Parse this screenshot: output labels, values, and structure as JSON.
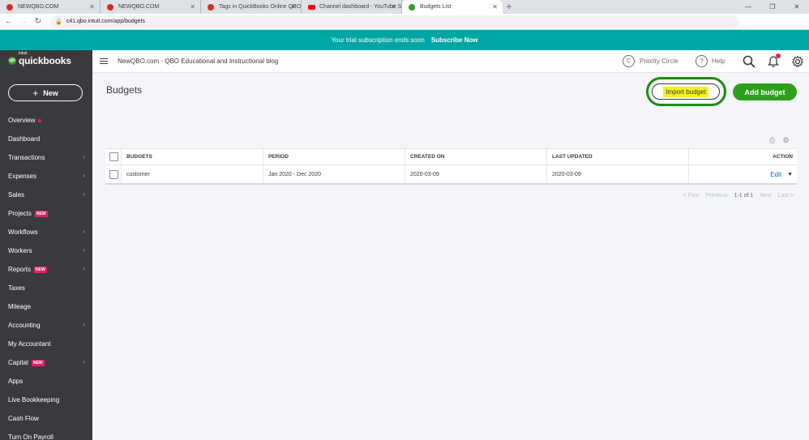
{
  "browser": {
    "tabs": [
      {
        "label": "NEWQBO.COM",
        "icon": "red-circle-icon",
        "active": false
      },
      {
        "label": "NEWQBO.COM",
        "icon": "red-circle-icon",
        "active": false
      },
      {
        "label": "Tags in QuickBooks Online QBO -",
        "icon": "red-circle-icon",
        "active": false
      },
      {
        "label": "Channel dashboard - YouTube St",
        "icon": "youtube-icon",
        "active": false
      },
      {
        "label": "Budgets List",
        "icon": "quickbooks-icon",
        "active": true
      }
    ],
    "url": "c41.qbo.intuit.com/app/budgets"
  },
  "banner": {
    "text": "Your trial subscription ends soon",
    "cta": "Subscribe Now"
  },
  "sidebar": {
    "logo_small": "intuit",
    "logo": "quickbooks",
    "new_label": "New",
    "items": [
      {
        "label": "Overview",
        "dot": true,
        "chevron": false,
        "badge": ""
      },
      {
        "label": "Dashboard",
        "dot": false,
        "chevron": false,
        "badge": ""
      },
      {
        "label": "Transactions",
        "dot": false,
        "chevron": true,
        "badge": ""
      },
      {
        "label": "Expenses",
        "dot": false,
        "chevron": true,
        "badge": ""
      },
      {
        "label": "Sales",
        "dot": false,
        "chevron": true,
        "badge": ""
      },
      {
        "label": "Projects",
        "dot": false,
        "chevron": false,
        "badge": "NEW"
      },
      {
        "label": "Workflows",
        "dot": false,
        "chevron": true,
        "badge": ""
      },
      {
        "label": "Workers",
        "dot": false,
        "chevron": true,
        "badge": ""
      },
      {
        "label": "Reports",
        "dot": false,
        "chevron": true,
        "badge": "NEW"
      },
      {
        "label": "Taxes",
        "dot": false,
        "chevron": false,
        "badge": ""
      },
      {
        "label": "Mileage",
        "dot": false,
        "chevron": false,
        "badge": ""
      },
      {
        "label": "Accounting",
        "dot": false,
        "chevron": true,
        "badge": ""
      },
      {
        "label": "My Accountant",
        "dot": false,
        "chevron": false,
        "badge": ""
      },
      {
        "label": "Capital",
        "dot": false,
        "chevron": true,
        "badge": "NEW"
      },
      {
        "label": "Apps",
        "dot": false,
        "chevron": false,
        "badge": ""
      },
      {
        "label": "Live Bookkeeping",
        "dot": false,
        "chevron": false,
        "badge": ""
      },
      {
        "label": "Cash Flow",
        "dot": false,
        "chevron": false,
        "badge": ""
      },
      {
        "label": "Turn On Payroll",
        "dot": false,
        "chevron": false,
        "badge": ""
      }
    ]
  },
  "header": {
    "company": "NewQBO.com - QBO Educational and Instructional blog",
    "priority_circle": "Priority Circle",
    "help": "Help"
  },
  "main": {
    "title": "Budgets",
    "import_button": "Import budget",
    "add_button": "Add budget",
    "table": {
      "columns": [
        "BUDGETS",
        "PERIOD",
        "CREATED ON",
        "LAST UPDATED",
        "ACTION"
      ],
      "rows": [
        {
          "name": "customer",
          "period": "Jan 2020 - Dec 2020",
          "created": "2020-03-09",
          "updated": "2020-03-09",
          "action": "Edit"
        }
      ]
    },
    "pager": {
      "first": "< First",
      "previous": "Previous",
      "range": "1-1 of 1",
      "next": "Next",
      "last": "Last >"
    }
  },
  "colors": {
    "brand_green": "#2ca01c",
    "banner_teal": "#00a6a4",
    "sidebar_bg": "#393a3d",
    "accent_pink": "#e0245e",
    "link_blue": "#0077c5"
  }
}
